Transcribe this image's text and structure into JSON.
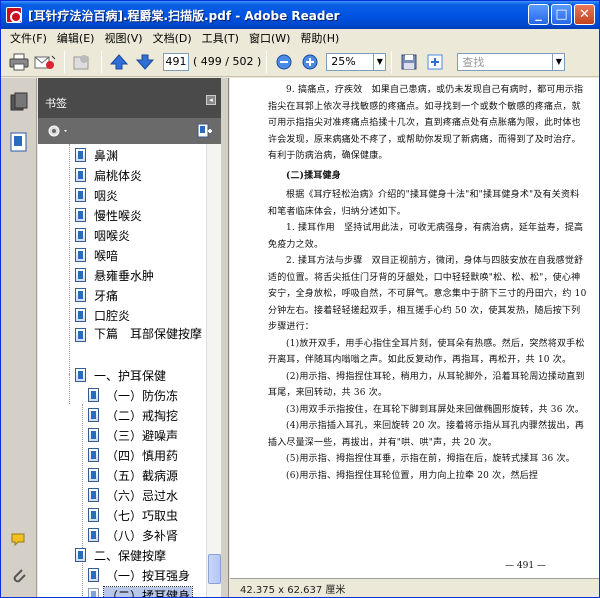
{
  "window": {
    "title": "[耳针疗法治百病].程爵棠.扫描版.pdf - Adobe Reader",
    "controls": {
      "minimize": "_",
      "maximize": "□",
      "close": "✕"
    }
  },
  "menubar": {
    "items": [
      "文件(F)",
      "编辑(E)",
      "视图(V)",
      "文档(D)",
      "工具(T)",
      "窗口(W)",
      "帮助(H)"
    ]
  },
  "toolbar": {
    "page_current": "491",
    "page_total": "( 499 / 502 )",
    "zoom": "25%",
    "search_placeholder": "查找",
    "icons": [
      "print-icon",
      "email-icon",
      "upload-icon",
      "page-up-icon",
      "page-down-icon",
      "zoom-out-icon",
      "zoom-in-icon",
      "save-icon",
      "fit-page-icon"
    ]
  },
  "bookmarks": {
    "header": "书签",
    "items": [
      {
        "label": "鼻渊"
      },
      {
        "label": "扁桃体炎"
      },
      {
        "label": "咽炎"
      },
      {
        "label": "慢性喉炎"
      },
      {
        "label": "咽喉炎"
      },
      {
        "label": "喉喑"
      },
      {
        "label": "悬雍垂水肿"
      },
      {
        "label": "牙痛"
      },
      {
        "label": "口腔炎"
      },
      {
        "label": "下篇　耳部保健按摩"
      },
      {
        "label": "一、护耳保健"
      },
      {
        "label": "（一）防伤冻"
      },
      {
        "label": "（二）戒掏挖"
      },
      {
        "label": "（三）避噪声"
      },
      {
        "label": "（四）慎用药"
      },
      {
        "label": "（五）截病源"
      },
      {
        "label": "（六）忌过水"
      },
      {
        "label": "（七）巧取虫"
      },
      {
        "label": "（八）多补肾"
      },
      {
        "label": "二、保健按摩"
      },
      {
        "label": "（一）按耳强身"
      },
      {
        "label": "（二）揉耳健身"
      }
    ]
  },
  "document": {
    "paragraphs": [
      {
        "type": "first",
        "text": "9. 搞痛点，疗疾效　如果自己患病，或仍未发现自己有病时，都可用示指指尖在耳郭上依次寻找敏感的疼痛点。如寻找到一个或数个敏感的疼痛点，就可用示指指尖对准疼痛点掐揉十几次，直到疼痛点处有点胀痛为限，此时体也许会发现，原来病痛处不疼了，或帮助你发现了新病痛，而得到了及时治疗。有利于防病治病，确保健康。"
      },
      {
        "type": "heading",
        "text": "(二)揉耳健身"
      },
      {
        "type": "ind",
        "text": "根据《耳疗轻松治病》介绍的\"揉耳健身十法\"和\"揉耳健身术\"及有关资料和笔者临床体会，归纳分述如下。"
      },
      {
        "type": "ind",
        "text": "1. 揉耳作用　坚持试用此法，可收无病强身，有病治病，延年益寿，提高免疫力之效。"
      },
      {
        "type": "ind",
        "text": "2. 揉耳方法与步骤　双目正视前方，微闭，身体与四肢安放在自我感觉舒适的位置。将舌尖抵住门牙背的牙龈处，口中轻轻默唤\"松、松、松\"，使心神安宁，全身放松，呼吸自然，不可屏气。意念集中于脐下三寸的丹田穴，约 10 分钟左右。接着轻轻搓起双手，相互搓手心约 50 次，使其发热，随后按下列步骤进行："
      },
      {
        "type": "ind",
        "text": "(1)放开双手，用手心指住全耳片刻，使耳朵有热感。然后，突然将双手松开离耳，伴随耳内嗡嗡之声。如此反复动作，再指耳，再松开，共 10 次。"
      },
      {
        "type": "ind",
        "text": "(2)用示指、拇指捏住耳轮，稍用力，从耳轮脚外，沿着耳轮周边揉动直到耳尾，来回转动，共 36 次。"
      },
      {
        "type": "ind",
        "text": "(3)用双手示指按住，在耳轮下脚到耳屏处来回做椭圆形旋转，共 36 次。"
      },
      {
        "type": "ind",
        "text": "(4)用示指插入耳孔，来回旋转 20 次。接着将示指从耳孔内骤然拔出，再插入尽量深一些，再拔出，并有\"哄、哄\"声，共 20 次。"
      },
      {
        "type": "ind",
        "text": "(5)用示指、拇指捏住耳垂，示指在前，拇指在后，旋转式揉耳 36 次。"
      },
      {
        "type": "ind",
        "text": "(6)用示指、拇指捏住耳轮位置，用力向上拉牵 20 次，然后捏"
      }
    ],
    "page_number": "— 491 —"
  },
  "statusbar": {
    "dimensions": "42.375 x 62.637 厘米"
  }
}
